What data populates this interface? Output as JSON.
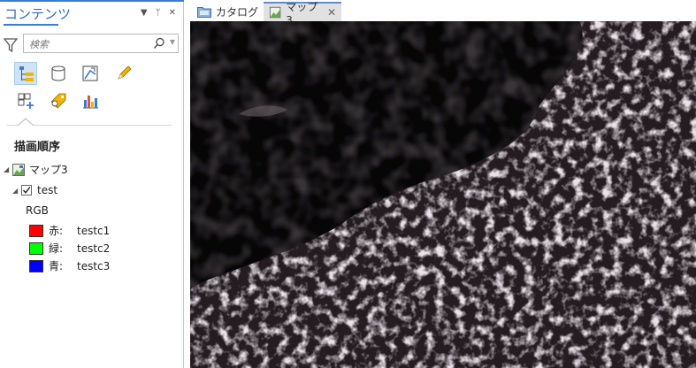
{
  "contents_pane": {
    "title": "コンテンツ",
    "controls": [
      "▼",
      "ᛘ",
      "✕"
    ],
    "search": {
      "placeholder": "検索",
      "value": ""
    },
    "section_heading": "描画順序",
    "map": {
      "name": "マップ3",
      "expanded": true
    },
    "layer": {
      "name": "test",
      "checked": true,
      "expanded": true
    },
    "renderer": "RGB",
    "bands": [
      {
        "channel": "赤:",
        "band": "testc1",
        "color": "#ff0000"
      },
      {
        "channel": "緑:",
        "band": "testc2",
        "color": "#00ff00"
      },
      {
        "channel": "青:",
        "band": "testc3",
        "color": "#0000ff"
      }
    ],
    "toolbar_icons": [
      "list-by-drawing-order-icon",
      "list-by-data-source-icon",
      "list-by-selection-icon",
      "list-by-editing-icon",
      "list-by-snapping-icon",
      "list-by-labeling-icon",
      "list-by-charts-icon"
    ]
  },
  "tabs": [
    {
      "label": "カタログ",
      "icon": "catalog-icon",
      "active": false
    },
    {
      "label": "マップ3",
      "icon": "map-icon",
      "active": true,
      "close": "✕"
    }
  ],
  "colors": {
    "accent": "#3a7bd5",
    "tool_active": "#cfe3f7",
    "map_background": "#070607",
    "cloud": "#c9bcc4"
  }
}
